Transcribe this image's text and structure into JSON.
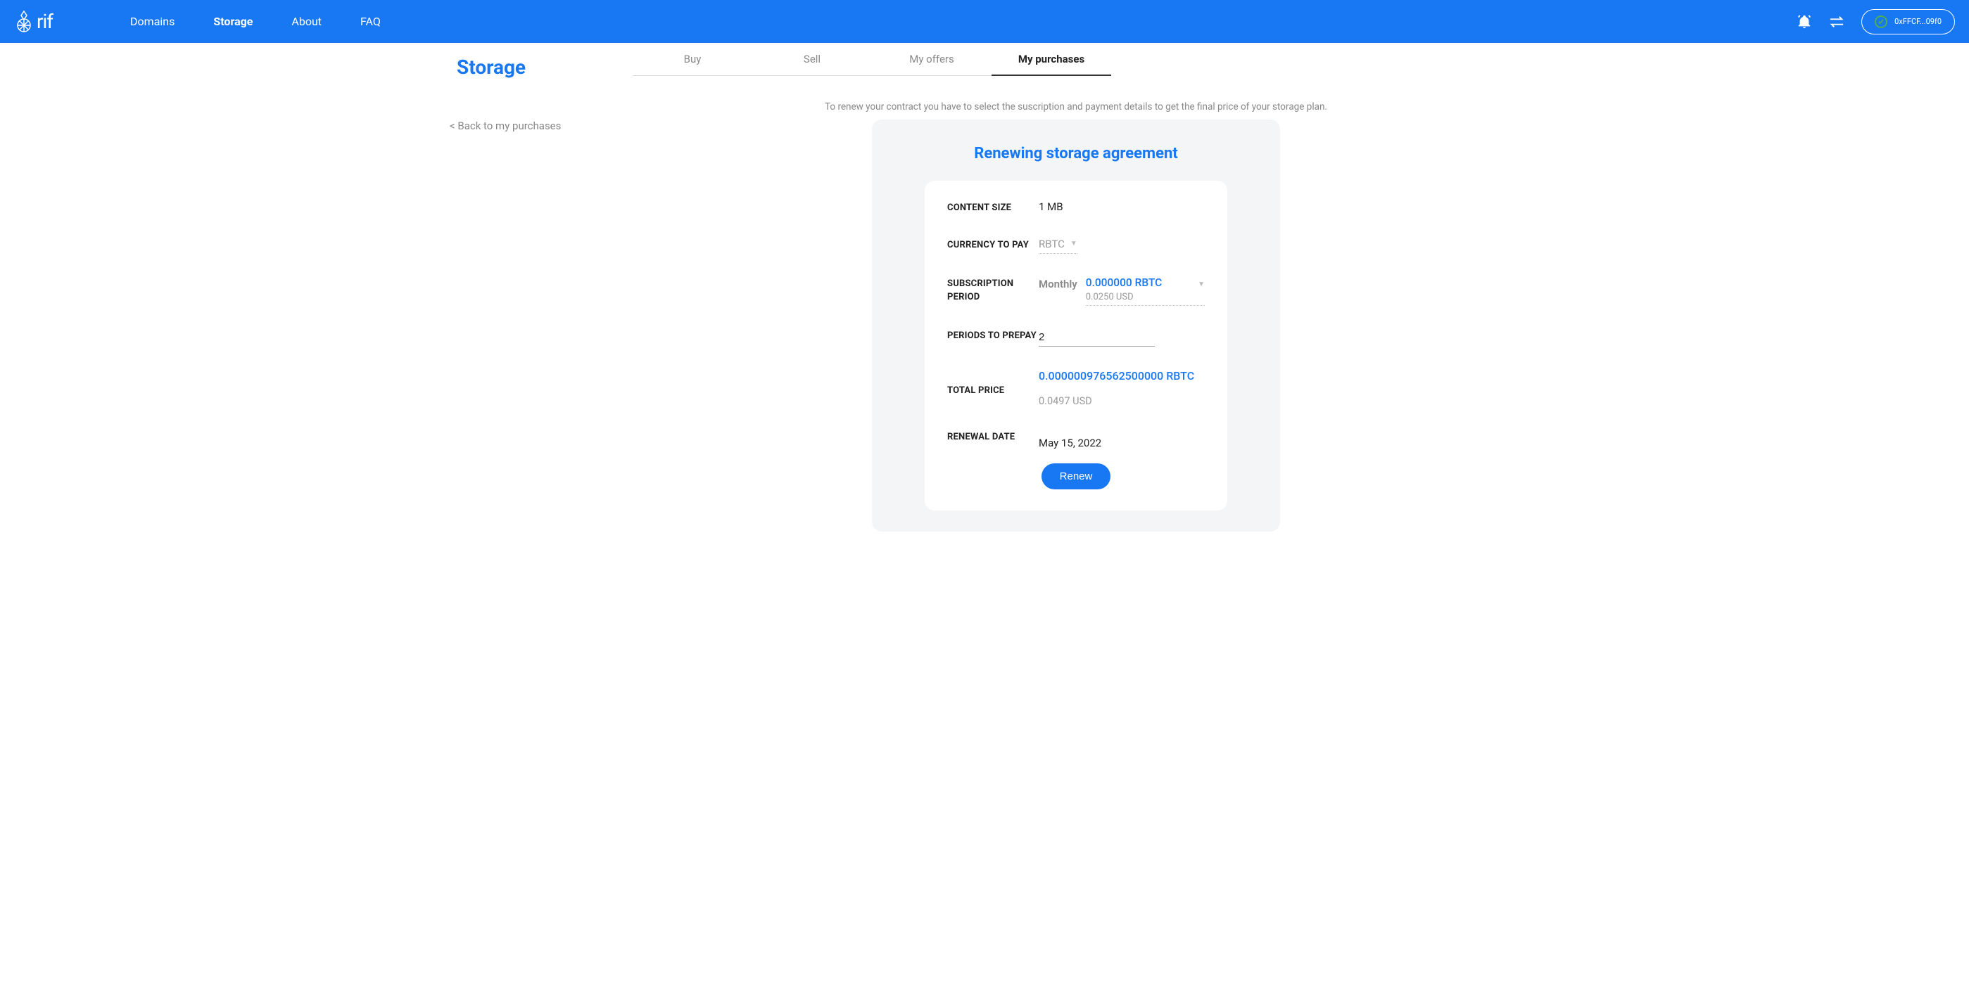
{
  "brand": "rif",
  "nav": {
    "items": [
      {
        "label": "Domains"
      },
      {
        "label": "Storage"
      },
      {
        "label": "About"
      },
      {
        "label": "FAQ"
      }
    ],
    "active": "Storage"
  },
  "wallet": {
    "address": "0xFFCF...09f0"
  },
  "page_title": "Storage",
  "back_link": "< Back to my purchases",
  "tabs": {
    "items": [
      {
        "label": "Buy"
      },
      {
        "label": "Sell"
      },
      {
        "label": "My offers"
      },
      {
        "label": "My purchases"
      }
    ],
    "active": "My purchases"
  },
  "instruction": "To renew your contract you have to select the suscription and payment details to get the final price of your storage plan.",
  "card_title": "Renewing storage agreement",
  "form": {
    "content_size_label": "CONTENT SIZE",
    "content_size_value": "1 MB",
    "currency_label": "CURRENCY TO PAY",
    "currency_value": "RBTC",
    "sub_period_label": "SUBSCRIPTION PERIOD",
    "sub_period_interval": "Monthly",
    "sub_period_price": "0.000000 RBTC",
    "sub_period_usd": "0.0250 USD",
    "prepay_label": "PERIODS TO PREPAY",
    "prepay_value": "2",
    "total_label": "TOTAL PRICE",
    "total_primary": "0.000000976562500000 RBTC",
    "total_usd": "0.0497 USD",
    "renewal_label": "RENEWAL DATE",
    "renewal_value": "May 15, 2022",
    "renew_btn": "Renew"
  }
}
